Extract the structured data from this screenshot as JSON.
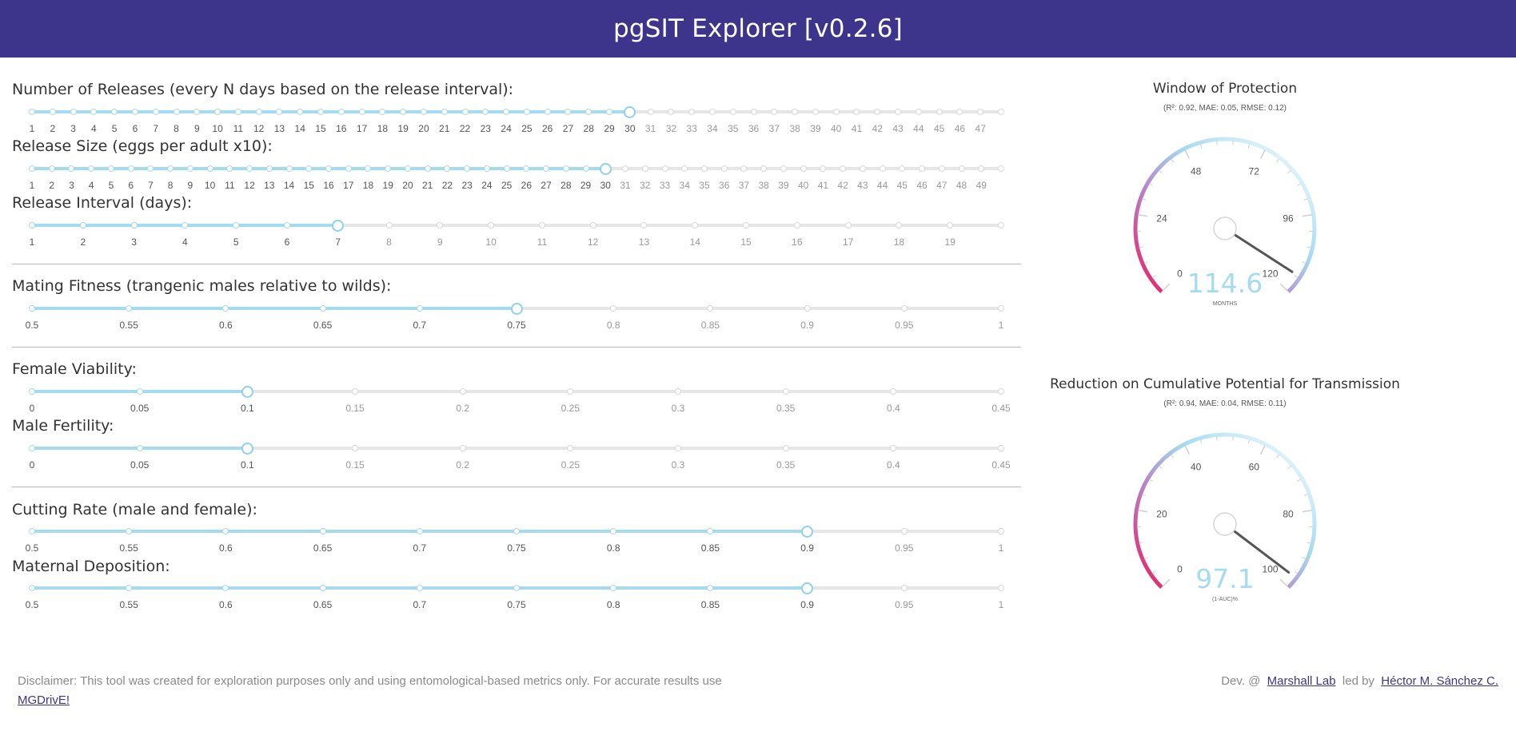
{
  "header": {
    "title": "pgSIT Explorer [v0.2.6]"
  },
  "colors": {
    "header_bg": "#3c358b",
    "slider_fill": "#a4dbf0",
    "gauge_value": "#a4dbf0",
    "gauge_low": "#e91e63"
  },
  "sliders": [
    {
      "id": "releases",
      "label": "Number of Releases (every N days based on the release interval):",
      "ticks": [
        "1",
        "2",
        "3",
        "4",
        "5",
        "6",
        "7",
        "8",
        "9",
        "10",
        "11",
        "12",
        "13",
        "14",
        "15",
        "16",
        "17",
        "18",
        "19",
        "20",
        "21",
        "22",
        "23",
        "24",
        "25",
        "26",
        "27",
        "28",
        "29",
        "30",
        "31",
        "32",
        "33",
        "34",
        "35",
        "36",
        "37",
        "38",
        "39",
        "40",
        "41",
        "42",
        "43",
        "44",
        "45",
        "46",
        "47",
        ""
      ],
      "value_index": 29
    },
    {
      "id": "release_size",
      "label": "Release Size (eggs per adult x10):",
      "ticks": [
        "1",
        "2",
        "3",
        "4",
        "5",
        "6",
        "7",
        "8",
        "9",
        "10",
        "11",
        "12",
        "13",
        "14",
        "15",
        "16",
        "17",
        "18",
        "19",
        "20",
        "21",
        "22",
        "23",
        "24",
        "25",
        "26",
        "27",
        "28",
        "29",
        "30",
        "31",
        "32",
        "33",
        "34",
        "35",
        "36",
        "37",
        "38",
        "39",
        "40",
        "41",
        "42",
        "43",
        "44",
        "45",
        "46",
        "47",
        "48",
        "49",
        ""
      ],
      "value_index": 29
    },
    {
      "id": "release_interval",
      "label": "Release Interval (days):",
      "ticks": [
        "1",
        "2",
        "3",
        "4",
        "5",
        "6",
        "7",
        "8",
        "9",
        "10",
        "11",
        "12",
        "13",
        "14",
        "15",
        "16",
        "17",
        "18",
        "19",
        ""
      ],
      "value_index": 6
    },
    {
      "id": "mating_fitness",
      "label": "Mating Fitness (trangenic males relative to wilds):",
      "ticks": [
        "0.5",
        "0.55",
        "0.6",
        "0.65",
        "0.7",
        "0.75",
        "0.8",
        "0.85",
        "0.9",
        "0.95",
        "1"
      ],
      "value_index": 5
    },
    {
      "id": "female_viability",
      "label": "Female Viability:",
      "ticks": [
        "0",
        "0.05",
        "0.1",
        "0.15",
        "0.2",
        "0.25",
        "0.3",
        "0.35",
        "0.4",
        "0.45"
      ],
      "value_index": 2
    },
    {
      "id": "male_fertility",
      "label": "Male Fertility:",
      "ticks": [
        "0",
        "0.05",
        "0.1",
        "0.15",
        "0.2",
        "0.25",
        "0.3",
        "0.35",
        "0.4",
        "0.45"
      ],
      "value_index": 2
    },
    {
      "id": "cutting_rate",
      "label": "Cutting Rate (male and female):",
      "ticks": [
        "0.5",
        "0.55",
        "0.6",
        "0.65",
        "0.7",
        "0.75",
        "0.8",
        "0.85",
        "0.9",
        "0.95",
        "1"
      ],
      "value_index": 8
    },
    {
      "id": "maternal_deposition",
      "label": "Maternal Deposition:",
      "ticks": [
        "0.5",
        "0.55",
        "0.6",
        "0.65",
        "0.7",
        "0.75",
        "0.8",
        "0.85",
        "0.9",
        "0.95",
        "1"
      ],
      "value_index": 8
    }
  ],
  "gauges": [
    {
      "title": "Window of Protection",
      "subtitle": "(R²: 0.92, MAE: 0.05, RMSE: 0.12)",
      "min": 0,
      "max": 120,
      "ticks": [
        "0",
        "24",
        "48",
        "72",
        "96",
        "120"
      ],
      "value": 114.6,
      "value_text": "114.6",
      "units": "MONTHS"
    },
    {
      "title": "Reduction on Cumulative Potential for Transmission",
      "subtitle": "(R²: 0.94, MAE: 0.04, RMSE: 0.11)",
      "min": 0,
      "max": 100,
      "ticks": [
        "0",
        "20",
        "40",
        "60",
        "80",
        "100"
      ],
      "value": 97.1,
      "value_text": "97.1",
      "units": "(1-AUC)%"
    }
  ],
  "footer": {
    "disclaimer": "Disclaimer: This tool was created for exploration purposes only and using entomological-based metrics only. For accurate results use",
    "mgdrive_link": "MGDrivE!",
    "dev_text": "Dev. @",
    "lab_link": "Marshall Lab",
    "led_by": "led by",
    "author_link": "Héctor M. Sánchez C."
  }
}
